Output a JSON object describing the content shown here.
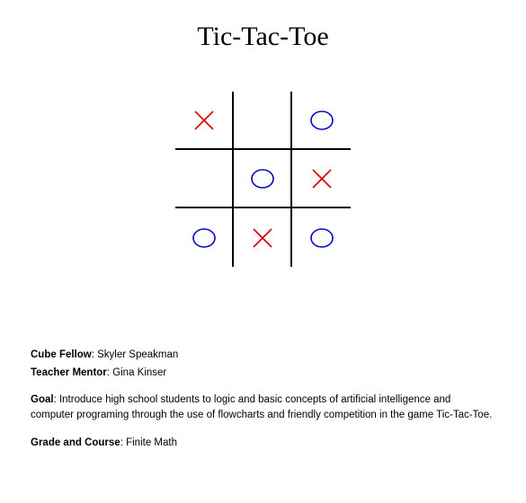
{
  "title": "Tic-Tac-Toe",
  "board": {
    "cells": [
      [
        "X",
        "",
        "O"
      ],
      [
        "",
        "O",
        "X"
      ],
      [
        "O",
        "X",
        "O"
      ]
    ],
    "colors": {
      "X": "#d40000",
      "O": "#0000cc"
    }
  },
  "info": {
    "fellow_label": "Cube Fellow",
    "fellow_value": "Skyler Speakman",
    "mentor_label": "Teacher Mentor",
    "mentor_value": "Gina Kinser",
    "goal_label": "Goal",
    "goal_value": "Introduce high school students to logic and basic concepts of artificial intelligence and computer programing through the use of flowcharts and friendly competition in the game Tic-Tac-Toe.",
    "grade_label": "Grade and Course",
    "grade_value": "Finite Math"
  }
}
